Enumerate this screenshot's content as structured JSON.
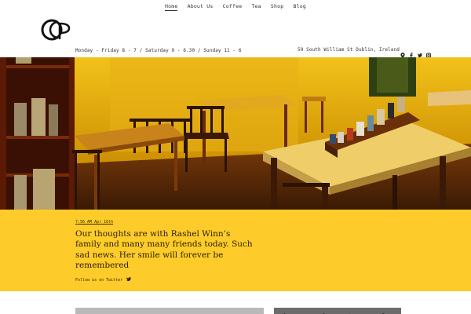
{
  "nav": {
    "items": [
      {
        "label": "Home",
        "active": true
      },
      {
        "label": "About Us"
      },
      {
        "label": "Coffee"
      },
      {
        "label": "Tea"
      },
      {
        "label": "Shop"
      },
      {
        "label": "Blog"
      }
    ]
  },
  "logo": {
    "icon": "ccp-monogram-logo"
  },
  "info": {
    "hours": "Monday - Friday 8 - 7 / Saturday 9 - 6.30 / Sunday 11 - 6",
    "address": "50 South William St Dublin, Ireland",
    "social_icons": [
      "location-pin-icon",
      "facebook-icon",
      "twitter-icon",
      "instagram-icon"
    ]
  },
  "hero": {
    "icon": "cafe-interior-photo"
  },
  "post": {
    "timestamp": "7:56 AM Apr 16th",
    "text": "Our thoughts are with Rashel Winn’s family and many many friends today. Such sad news. Her smile will forever be remembered",
    "follow_label": "Follow us on Twitter"
  },
  "colors": {
    "band": "#fdcc2a",
    "text": "#2a1e00"
  }
}
